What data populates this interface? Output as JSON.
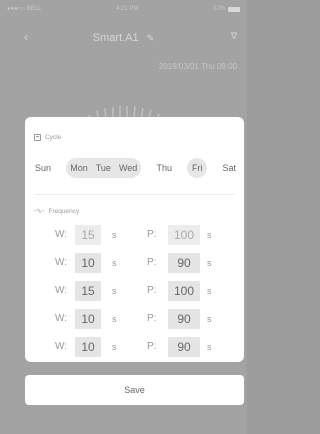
{
  "status_bar": {
    "carrier": "●●●○○ BELL",
    "time": "4:21 PM",
    "battery": "22%"
  },
  "nav": {
    "title": "Smart.A1",
    "back_icon": "chevron-left-icon",
    "edit_icon": "pencil-icon",
    "bluetooth_icon": "bluetooth-icon"
  },
  "datetime": "2019/03/01 Thu 09:00",
  "cycle": {
    "label": "Cycle",
    "days": [
      {
        "label": "Sun",
        "selected": false
      },
      {
        "label": "Mon",
        "selected": true
      },
      {
        "label": "Tue",
        "selected": true
      },
      {
        "label": "Wed",
        "selected": true
      },
      {
        "label": "Thu",
        "selected": false
      },
      {
        "label": "Fri",
        "selected": true
      },
      {
        "label": "Sat",
        "selected": false
      }
    ]
  },
  "frequency": {
    "label": "Frequency",
    "w_label": "W:",
    "p_label": "P:",
    "unit": "s",
    "rows": [
      {
        "w": "15",
        "p": "100",
        "active": false
      },
      {
        "w": "10",
        "p": "90",
        "active": true
      },
      {
        "w": "15",
        "p": "100",
        "active": true
      },
      {
        "w": "10",
        "p": "90",
        "active": true
      },
      {
        "w": "10",
        "p": "90",
        "active": true
      }
    ]
  },
  "save_label": "Save"
}
